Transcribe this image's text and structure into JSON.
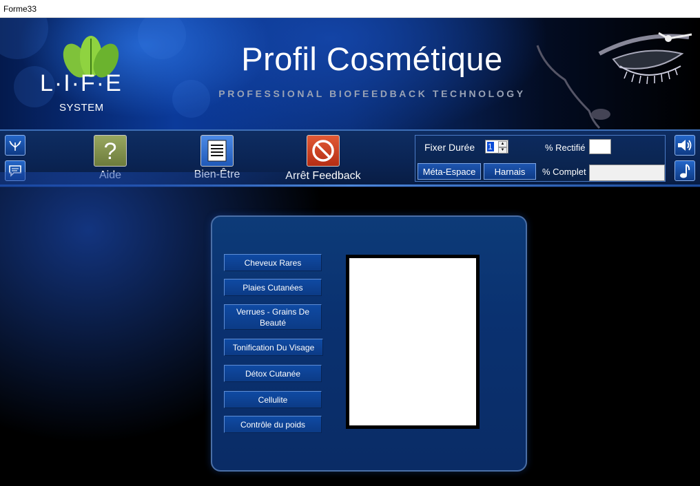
{
  "window": {
    "title": "Forme33"
  },
  "banner": {
    "title": "Profil Cosmétique",
    "subtitle": "PROFESSIONAL BIOFEEDBACK TECHNOLOGY",
    "logo_letters": "L·I·F·E",
    "logo_system": "SYSTEM"
  },
  "toolbar": {
    "side_buttons": [
      {
        "icon": "signal-icon"
      },
      {
        "icon": "chat-icon"
      }
    ],
    "aide_label": "Aide",
    "bien_etre_label": "Bien-Être",
    "arret_label": "Arrêt Feedback",
    "fixer_duree_label": "Fixer Durée",
    "duration_value": "1",
    "rectifie_label": "% Rectifié",
    "complet_label": "% Complet",
    "meta_espace_label": "Méta-Espace",
    "harnais_label": "Harnais",
    "sound_icon": "speaker-icon",
    "music_icon": "music-note-icon"
  },
  "menu": {
    "items": [
      "Cheveux Rares",
      "Plaies Cutanées",
      "Verrues - Grains De Beauté",
      "Tonification Du Visage",
      "Détox Cutanée",
      "Cellulite",
      "Contrôle du poids"
    ]
  },
  "colors": {
    "aide_tile": "#7d8b4a",
    "bien_etre_tile": "#2f6fd0",
    "arret_tile": "#cc3a1c",
    "panel": "#0a3170",
    "menu_button": "#0e4499"
  }
}
